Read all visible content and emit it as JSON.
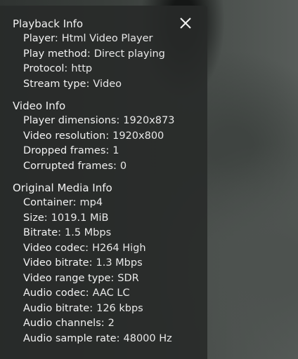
{
  "panel": {
    "close_icon": "close-icon",
    "sections": [
      {
        "title": "Playback Info",
        "rows": [
          {
            "label": "Player:",
            "value": "Html Video Player"
          },
          {
            "label": "Play method:",
            "value": "Direct playing"
          },
          {
            "label": "Protocol:",
            "value": "http"
          },
          {
            "label": "Stream type:",
            "value": "Video"
          }
        ]
      },
      {
        "title": "Video Info",
        "rows": [
          {
            "label": "Player dimensions:",
            "value": "1920x873"
          },
          {
            "label": "Video resolution:",
            "value": "1920x800"
          },
          {
            "label": "Dropped frames:",
            "value": "1"
          },
          {
            "label": "Corrupted frames:",
            "value": "0"
          }
        ]
      },
      {
        "title": "Original Media Info",
        "rows": [
          {
            "label": "Container:",
            "value": "mp4"
          },
          {
            "label": "Size:",
            "value": "1019.1 MiB"
          },
          {
            "label": "Bitrate:",
            "value": "1.5 Mbps"
          },
          {
            "label": "Video codec:",
            "value": "H264 High"
          },
          {
            "label": "Video bitrate:",
            "value": "1.3 Mbps"
          },
          {
            "label": "Video range type:",
            "value": "SDR"
          },
          {
            "label": "Audio codec:",
            "value": "AAC LC"
          },
          {
            "label": "Audio bitrate:",
            "value": "126 kbps"
          },
          {
            "label": "Audio channels:",
            "value": "2"
          },
          {
            "label": "Audio sample rate:",
            "value": "48000 Hz"
          }
        ]
      }
    ]
  }
}
